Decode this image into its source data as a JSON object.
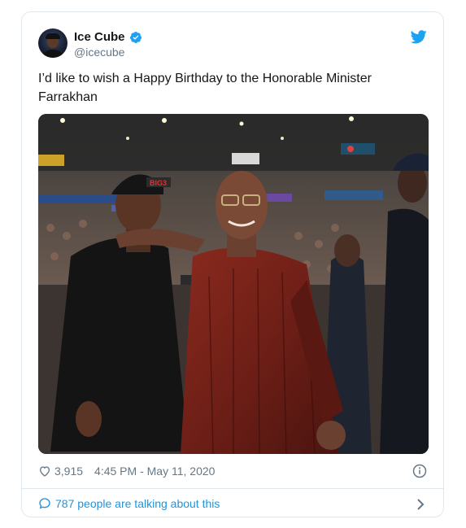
{
  "tweet": {
    "author": {
      "display_name": "Ice Cube",
      "handle": "@icecube",
      "verified": true
    },
    "text": "I’d like to wish a Happy Birthday to the Honorable Minister Farrakhan",
    "image_label": "BIG3",
    "likes": "3,915",
    "timestamp": "4:45 PM - May 11, 2020",
    "talking_text": "787 people are talking about this"
  },
  "icons": {
    "logo": "twitter-bird-icon",
    "verified": "verified-badge-icon",
    "like": "heart-icon",
    "info": "info-icon",
    "reply": "speech-bubble-icon",
    "more": "chevron-right-icon"
  },
  "colors": {
    "brand_blue": "#1da1f2",
    "link_blue": "#1b95e0",
    "text_primary": "#14171a",
    "text_secondary": "#657786",
    "border": "#e1e8ed"
  }
}
